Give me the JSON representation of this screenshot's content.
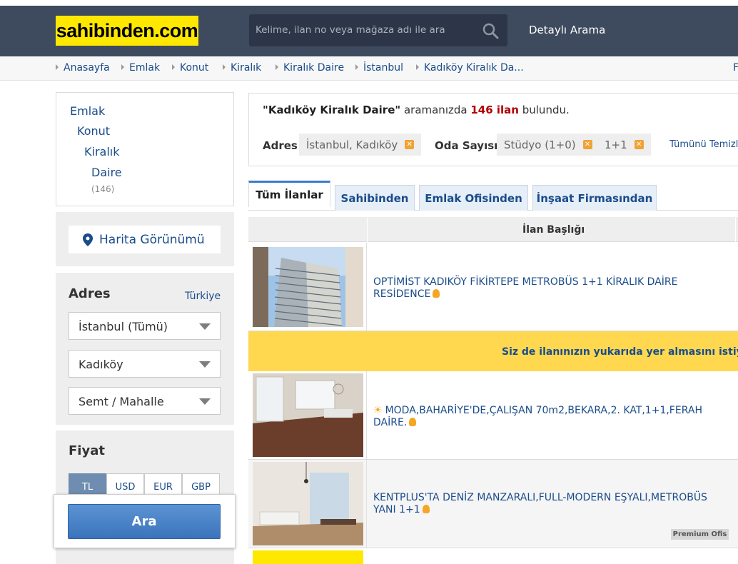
{
  "header": {
    "logo_text": "sahibinden.com",
    "search_placeholder": "Kelime, ilan no veya mağaza adı ile ara",
    "detailed_search": "Detaylı Arama"
  },
  "breadcrumb": [
    "Anasayfa",
    "Emlak",
    "Konut",
    "Kiralık",
    "Kiralık Daire",
    "İstanbul",
    "Kadıköy Kiralık Da...",
    "F"
  ],
  "sidebar": {
    "categories": [
      "Emlak",
      "Konut",
      "Kiralık",
      "Daire"
    ],
    "category_count": "(146)",
    "map_view": "Harita Görünümü",
    "address_title": "Adres",
    "address_country": "Türkiye",
    "address_selects": [
      "İstanbul (Tümü)",
      "Kadıköy",
      "Semt / Mahalle"
    ],
    "price_title": "Fiyat",
    "currencies": [
      "TL",
      "USD",
      "EUR",
      "GBP"
    ],
    "search_button": "Ara"
  },
  "summary": {
    "query": "\"Kadıköy Kiralık Daire\"",
    "middle": " aramanızda ",
    "count": "146 ilan",
    "suffix": " bulundu.",
    "filters": {
      "address_label": "Adres",
      "address_value": "İstanbul, Kadıköy",
      "rooms_label": "Oda Sayısı",
      "rooms_values": [
        "Stüdyo (1+0)",
        "1+1"
      ],
      "clear_all": "Tümünü Temizl"
    }
  },
  "tabs": [
    "Tüm İlanlar",
    "Sahibinden",
    "Emlak Ofisinden",
    "İnşaat Firmasından"
  ],
  "table": {
    "column_title": "İlan Başlığı",
    "promo": "Siz de ilanınızın yukarıda yer almasını istiy",
    "listings": [
      {
        "title": "OPTİMİST KADIKÖY FİKİRTEPE METROBÜS 1+1 KİRALIK DAİRE RESİDENCE"
      },
      {
        "title": "MODA,BAHARİYE'DE,ÇALIŞAN 70m2,BEKARA,2. KAT,1+1,FERAH DAİRE."
      },
      {
        "title": "KENTPLUS'TA DENİZ MANZARALI,FULL-MODERN EŞYALI,METROBÜS YANI 1+1",
        "badge": "Premium Ofis"
      }
    ]
  },
  "colors": {
    "header_bg": "#3e4a5e",
    "logo_bg": "#ffe800",
    "link": "#1a4c8a",
    "promo_bg": "#ffd84f",
    "count_red": "#b00000"
  }
}
